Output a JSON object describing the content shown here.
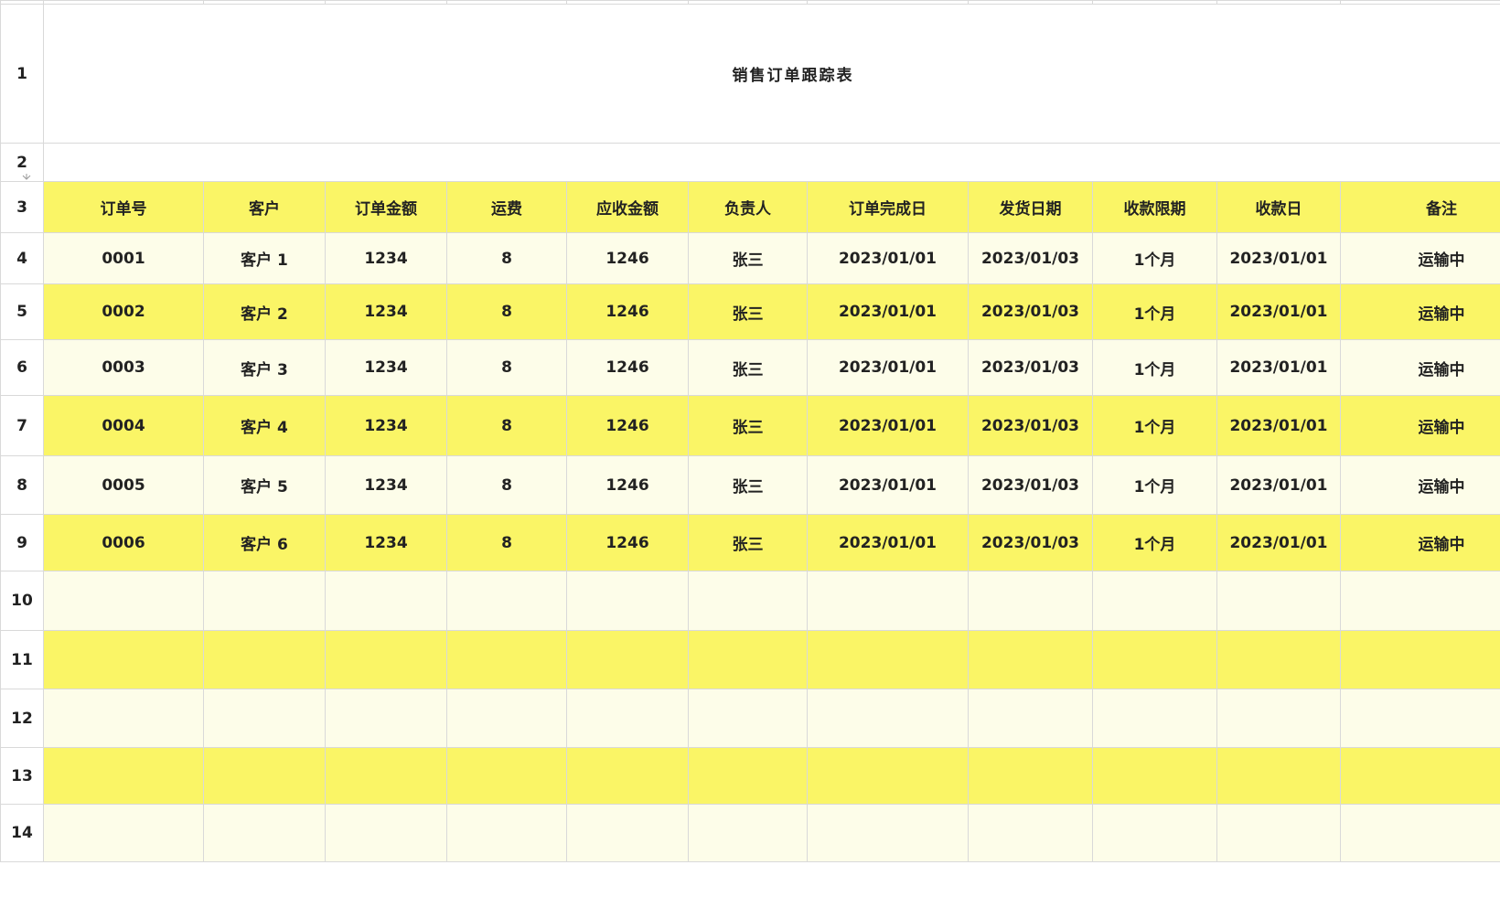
{
  "title": "销售订单跟踪表",
  "row_numbers": [
    "1",
    "2",
    "3",
    "4",
    "5",
    "6",
    "7",
    "8",
    "9",
    "10",
    "11",
    "12",
    "13",
    "14"
  ],
  "columns": [
    "订单号",
    "客户",
    "订单金额",
    "运费",
    "应收金额",
    "负责人",
    "订单完成日",
    "发货日期",
    "收款限期",
    "收款日",
    "备注"
  ],
  "rows": [
    [
      "0001",
      "客户 1",
      "1234",
      "8",
      "1246",
      "张三",
      "2023/01/01",
      "2023/01/03",
      "1个月",
      "2023/01/01",
      "运输中"
    ],
    [
      "0002",
      "客户 2",
      "1234",
      "8",
      "1246",
      "张三",
      "2023/01/01",
      "2023/01/03",
      "1个月",
      "2023/01/01",
      "运输中"
    ],
    [
      "0003",
      "客户 3",
      "1234",
      "8",
      "1246",
      "张三",
      "2023/01/01",
      "2023/01/03",
      "1个月",
      "2023/01/01",
      "运输中"
    ],
    [
      "0004",
      "客户 4",
      "1234",
      "8",
      "1246",
      "张三",
      "2023/01/01",
      "2023/01/03",
      "1个月",
      "2023/01/01",
      "运输中"
    ],
    [
      "0005",
      "客户 5",
      "1234",
      "8",
      "1246",
      "张三",
      "2023/01/01",
      "2023/01/03",
      "1个月",
      "2023/01/01",
      "运输中"
    ],
    [
      "0006",
      "客户 6",
      "1234",
      "8",
      "1246",
      "张三",
      "2023/01/01",
      "2023/01/03",
      "1个月",
      "2023/01/01",
      "运输中"
    ]
  ],
  "colors": {
    "header_fill": "#faf566",
    "odd_row_fill": "#fdfde9",
    "even_row_fill": "#faf566",
    "grid_line": "#d9d9d9"
  }
}
